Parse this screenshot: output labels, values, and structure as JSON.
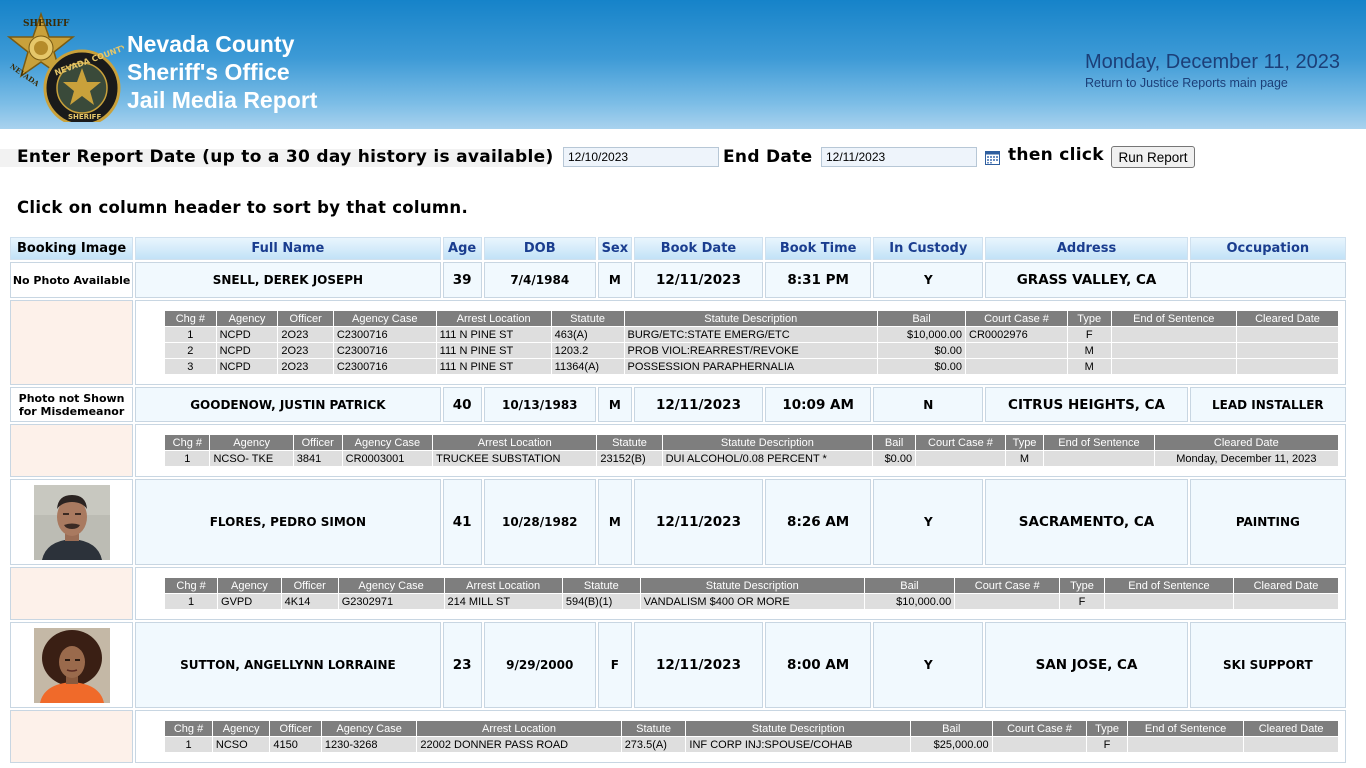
{
  "header": {
    "title_lines": [
      "Nevada County",
      "Sheriff's Office",
      "Jail Media Report"
    ],
    "date": "Monday, December 11, 2023",
    "return_link": "Return to Justice Reports main page",
    "logo_text": [
      "SHERIFF",
      "NEVADA",
      "NEVADA COUNTY",
      "SHERIFF"
    ]
  },
  "controls": {
    "prompt": "Enter Report Date (up to a 30 day history is available)",
    "start_date": "12/10/2023",
    "end_label": "End Date",
    "end_date": "12/11/2023",
    "then_click": "then click",
    "run_button": "Run Report",
    "sort_hint": "Click on column header to sort by that column."
  },
  "columns": [
    "Booking Image",
    "Full Name",
    "Age",
    "DOB",
    "Sex",
    "Book Date",
    "Book Time",
    "In Custody",
    "Address",
    "Occupation"
  ],
  "charge_columns": [
    "Chg #",
    "Agency",
    "Officer",
    "Agency Case",
    "Arrest Location",
    "Statute",
    "Statute Description",
    "Bail",
    "Court Case #",
    "Type",
    "End of Sentence",
    "Cleared Date"
  ],
  "bookings": [
    {
      "image_note": "No Photo Available",
      "name": "SNELL, DEREK JOSEPH",
      "age": "39",
      "dob": "7/4/1984",
      "sex": "M",
      "book_date": "12/11/2023",
      "book_time": "8:31 PM",
      "in_custody": "Y",
      "address": "GRASS VALLEY, CA",
      "occupation": "",
      "charges": [
        {
          "chg": "1",
          "agency": "NCPD",
          "officer": "2O23",
          "case": "C2300716",
          "location": "111 N PINE ST",
          "statute": "463(A)",
          "desc": "BURG/ETC:STATE EMERG/ETC",
          "bail": "$10,000.00",
          "court": "CR0002976",
          "type": "F",
          "end": "",
          "cleared": ""
        },
        {
          "chg": "2",
          "agency": "NCPD",
          "officer": "2O23",
          "case": "C2300716",
          "location": "111 N PINE ST",
          "statute": "1203.2",
          "desc": "PROB VIOL:REARREST/REVOKE",
          "bail": "$0.00",
          "court": "",
          "type": "M",
          "end": "",
          "cleared": ""
        },
        {
          "chg": "3",
          "agency": "NCPD",
          "officer": "2O23",
          "case": "C2300716",
          "location": "111 N PINE ST",
          "statute": "11364(A)",
          "desc": "POSSESSION PARAPHERNALIA",
          "bail": "$0.00",
          "court": "",
          "type": "M",
          "end": "",
          "cleared": ""
        }
      ]
    },
    {
      "image_note": "Photo not Shown for Misdemeanor",
      "name": "GOODENOW, JUSTIN PATRICK",
      "age": "40",
      "dob": "10/13/1983",
      "sex": "M",
      "book_date": "12/11/2023",
      "book_time": "10:09 AM",
      "in_custody": "N",
      "address": "CITRUS HEIGHTS, CA",
      "occupation": "LEAD INSTALLER",
      "charges": [
        {
          "chg": "1",
          "agency": "NCSO- TKE",
          "officer": "3841",
          "case": "CR0003001",
          "location": "TRUCKEE SUBSTATION",
          "statute": "23152(B)",
          "desc": "DUI ALCOHOL/0.08 PERCENT *",
          "bail": "$0.00",
          "court": "",
          "type": "M",
          "end": "",
          "cleared": "Monday, December 11, 2023"
        }
      ]
    },
    {
      "image_note": "",
      "photo": "male",
      "name": "FLORES, PEDRO SIMON",
      "age": "41",
      "dob": "10/28/1982",
      "sex": "M",
      "book_date": "12/11/2023",
      "book_time": "8:26 AM",
      "in_custody": "Y",
      "address": "SACRAMENTO, CA",
      "occupation": "PAINTING",
      "charges": [
        {
          "chg": "1",
          "agency": "GVPD",
          "officer": "4K14",
          "case": "G2302971",
          "location": "214 MILL ST",
          "statute": "594(B)(1)",
          "desc": "VANDALISM $400 OR MORE",
          "bail": "$10,000.00",
          "court": "",
          "type": "F",
          "end": "",
          "cleared": ""
        }
      ]
    },
    {
      "image_note": "",
      "photo": "female",
      "name": "SUTTON, ANGELLYNN LORRAINE",
      "age": "23",
      "dob": "9/29/2000",
      "sex": "F",
      "book_date": "12/11/2023",
      "book_time": "8:00 AM",
      "in_custody": "Y",
      "address": "SAN JOSE, CA",
      "occupation": "SKI SUPPORT",
      "charges": [
        {
          "chg": "1",
          "agency": "NCSO",
          "officer": "4150",
          "case": "1230-3268",
          "location": "22002 DONNER PASS ROAD",
          "statute": "273.5(A)",
          "desc": "INF CORP INJ:SPOUSE/COHAB",
          "bail": "$25,000.00",
          "court": "",
          "type": "F",
          "end": "",
          "cleared": ""
        }
      ]
    }
  ],
  "colors": {
    "header_top": "#1683c9",
    "header_bottom": "#a9d2ee",
    "col_header_text": "#1a3d8f",
    "charge_header": "#7e7e7e",
    "charge_cell": "#dedede",
    "spacer": "#fdf1ea"
  }
}
